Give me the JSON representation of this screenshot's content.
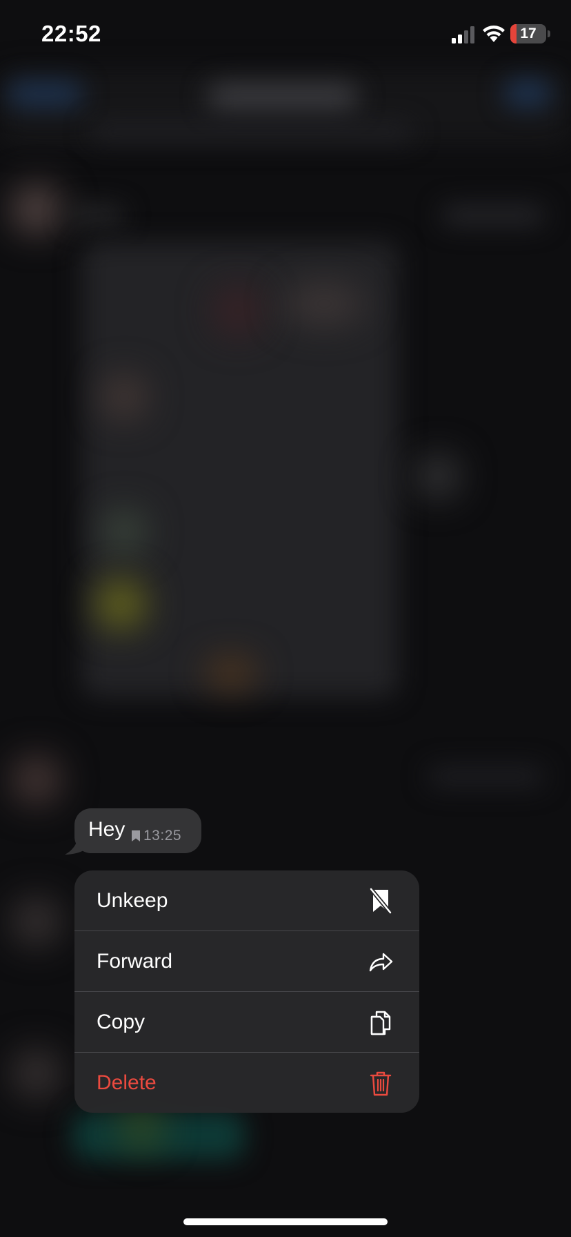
{
  "status_bar": {
    "time": "22:52",
    "battery_level": "17",
    "battery_fraction": 0.17
  },
  "message": {
    "text": "Hey",
    "time": "13:25",
    "kept_icon": "bookmark-icon"
  },
  "menu": {
    "items": [
      {
        "label": "Unkeep",
        "icon": "unbookmark-icon"
      },
      {
        "label": "Forward",
        "icon": "forward-arrow-icon"
      },
      {
        "label": "Copy",
        "icon": "copy-icon"
      },
      {
        "label": "Delete",
        "icon": "trash-icon",
        "destructive": true
      }
    ]
  },
  "colors": {
    "destructive": "#eb4a3f",
    "battery_low": "#e5443a",
    "bubble": "#343436",
    "menu_bg": "#28282a"
  }
}
